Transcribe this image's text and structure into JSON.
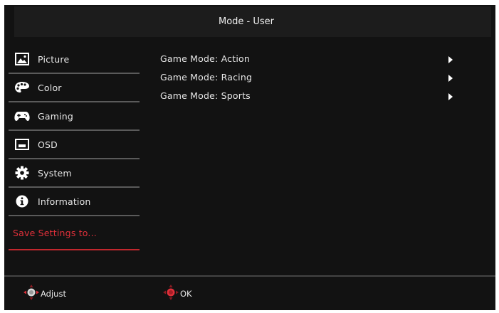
{
  "header": {
    "title": "Mode - User"
  },
  "sidebar": {
    "items": [
      {
        "label": "Picture",
        "icon": "picture-icon"
      },
      {
        "label": "Color",
        "icon": "color-palette-icon"
      },
      {
        "label": "Gaming",
        "icon": "gamepad-icon"
      },
      {
        "label": "OSD",
        "icon": "osd-icon"
      },
      {
        "label": "System",
        "icon": "gear-icon"
      },
      {
        "label": "Information",
        "icon": "info-icon"
      }
    ],
    "save_label": "Save Settings to..."
  },
  "main": {
    "options": [
      {
        "label": "Game Mode: Action"
      },
      {
        "label": "Game Mode: Racing"
      },
      {
        "label": "Game Mode: Sports"
      }
    ]
  },
  "footer": {
    "adjust_label": "Adjust",
    "ok_label": "OK"
  },
  "colors": {
    "background": "#121212",
    "title_bar": "#1c1c1c",
    "accent": "#e0303a",
    "divider": "#5a5a5a",
    "text": "#e6e6e6"
  }
}
